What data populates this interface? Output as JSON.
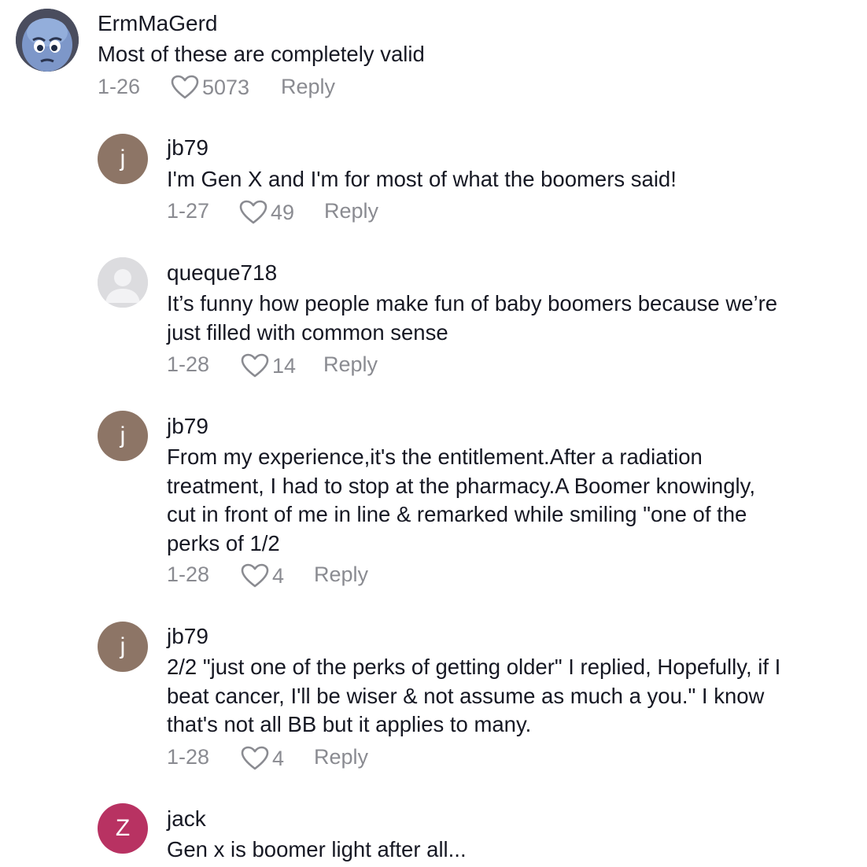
{
  "comments": [
    {
      "username": "ErmMaGerd",
      "avatar_icon": "blue-cartoon-face-icon",
      "text": "Most of these are completely valid",
      "date": "1-26",
      "likes": "5073",
      "reply_label": "Reply"
    },
    {
      "username": "jb79",
      "avatar_letter": "j",
      "avatar_color": "#8d7566",
      "text": "I'm Gen X and I'm for most of what the boomers said!",
      "date": "1-27",
      "likes": "49",
      "reply_label": "Reply"
    },
    {
      "username": "queque718",
      "avatar_icon": "default-person-icon",
      "avatar_color": "#d9d9dc",
      "text": "It’s funny how people make fun of baby boomers because we’re\njust filled with common sense",
      "date": "1-28",
      "likes": "14",
      "reply_label": "Reply"
    },
    {
      "username": "jb79",
      "avatar_letter": "j",
      "avatar_color": "#8d7566",
      "text": "From my experience,it's the entitlement.After a radiation\ntreatment, I had to stop at the pharmacy.A Boomer knowingly,\ncut in front of me in line & remarked while smiling \"one of the\nperks of 1/2",
      "date": "1-28",
      "likes": "4",
      "reply_label": "Reply"
    },
    {
      "username": "jb79",
      "avatar_letter": "j",
      "avatar_color": "#8d7566",
      "text": "2/2 \"just one of the perks of getting older\" I replied, Hopefully, if I\nbeat cancer, I'll be wiser & not assume as much a you.\" I know\nthat's not all BB but it applies to many.",
      "date": "1-28",
      "likes": "4",
      "reply_label": "Reply"
    },
    {
      "username": "jack",
      "avatar_letter": "Z",
      "avatar_color": "#b83262",
      "text": "Gen x is boomer light after all..."
    }
  ]
}
